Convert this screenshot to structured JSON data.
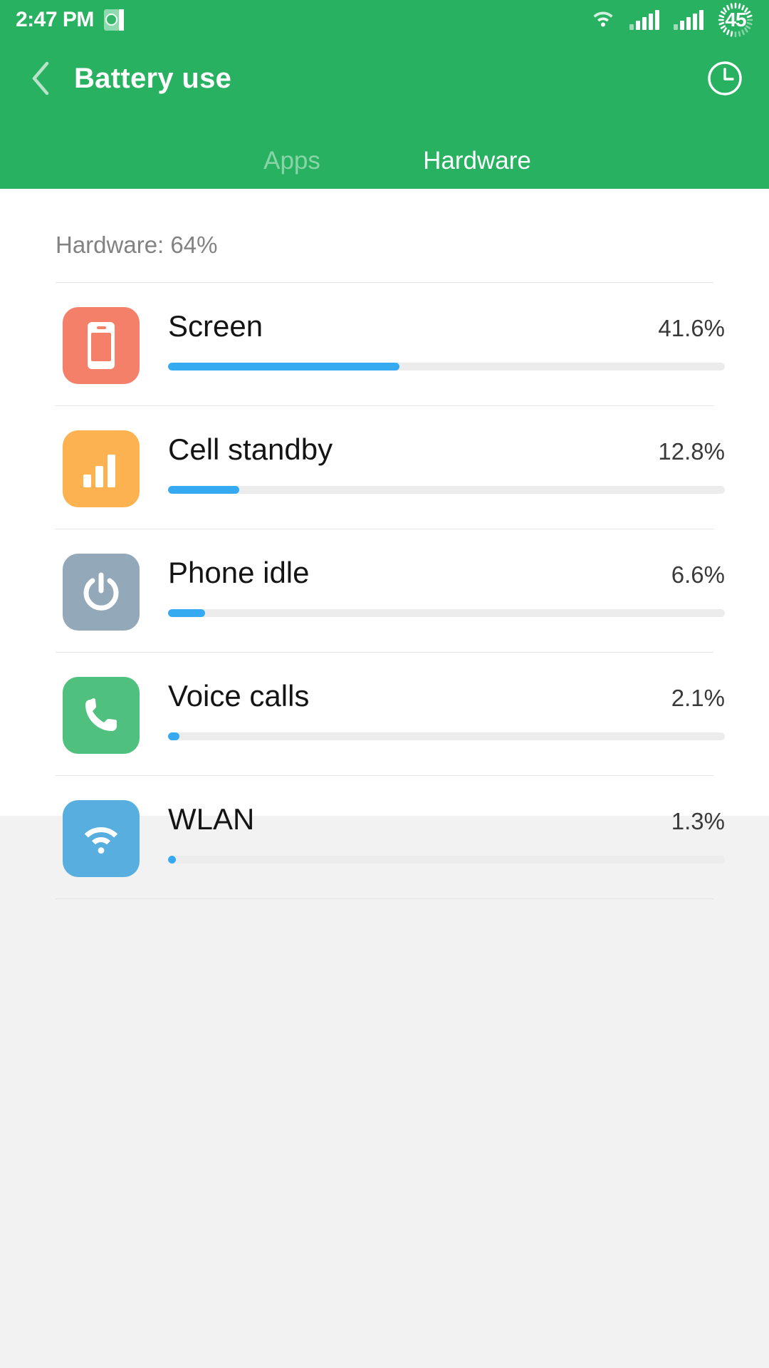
{
  "statusbar": {
    "time": "2:47 PM",
    "app_icon": "notification-app-icon",
    "wifi_icon": "wifi-icon",
    "signal_icon_1": "signal-bars-icon",
    "signal_icon_2": "signal-bars-icon",
    "battery_icon": "battery-circle-icon",
    "battery_level": "45"
  },
  "header": {
    "back_icon": "back-chevron-icon",
    "title": "Battery use",
    "action_icon": "clock-history-icon"
  },
  "tabs": [
    {
      "label": "Apps",
      "active": false
    },
    {
      "label": "Hardware",
      "active": true
    }
  ],
  "main": {
    "section_label": "Hardware: 64%",
    "rows": [
      {
        "name": "Screen",
        "percent": "41.6%",
        "value": 41.6,
        "icon": "screen-phone-icon",
        "icon_color": "#f4806a"
      },
      {
        "name": "Cell standby",
        "percent": "12.8%",
        "value": 12.8,
        "icon": "cell-signal-icon",
        "icon_color": "#fcb250"
      },
      {
        "name": "Phone idle",
        "percent": "6.6%",
        "value": 6.6,
        "icon": "power-icon",
        "icon_color": "#93a8b8"
      },
      {
        "name": "Voice calls",
        "percent": "2.1%",
        "value": 2.1,
        "icon": "phone-handset-icon",
        "icon_color": "#4fc07e"
      },
      {
        "name": "WLAN",
        "percent": "1.3%",
        "value": 1.3,
        "icon": "wifi-icon",
        "icon_color": "#59aee0"
      }
    ]
  },
  "colors": {
    "brand_green": "#27b160",
    "progress_blue": "#35aaf0",
    "track_gray": "#ececec",
    "page_bg": "#f2f2f2"
  }
}
